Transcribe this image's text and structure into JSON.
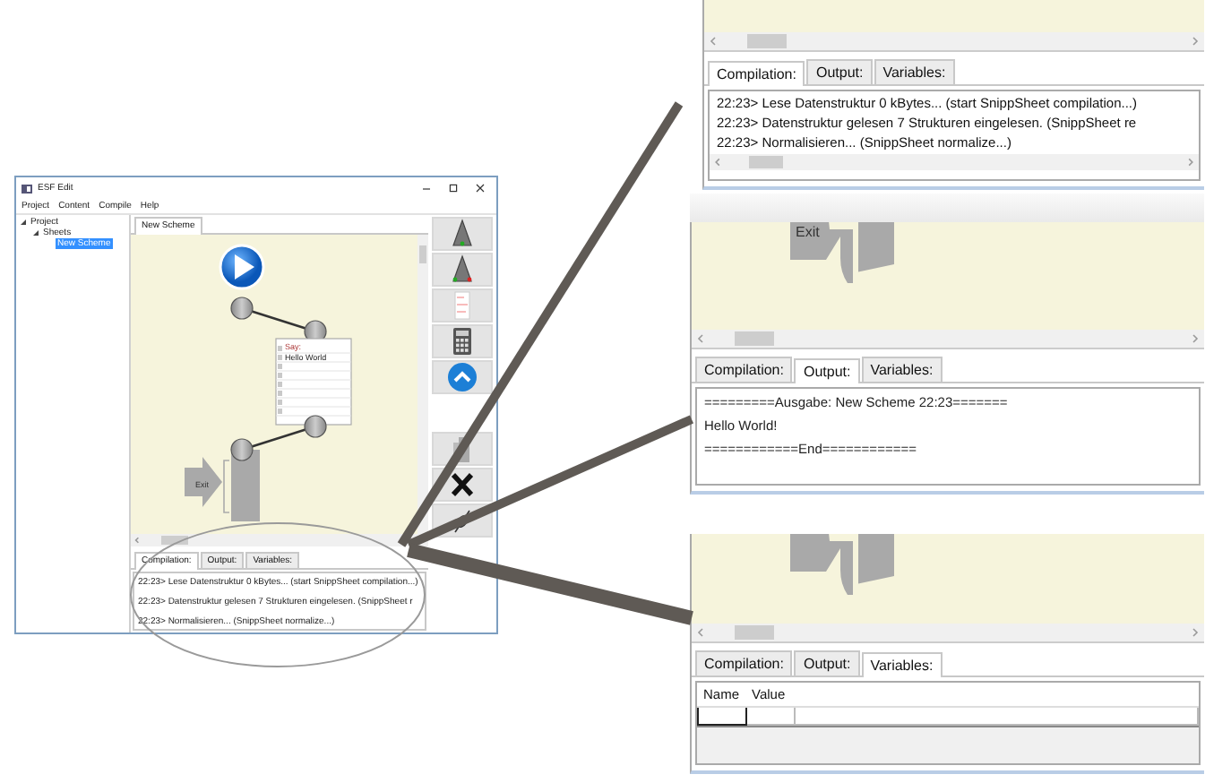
{
  "main_window": {
    "title": "ESF Edit",
    "menu": [
      "Project",
      "Content",
      "Compile",
      "Help"
    ],
    "tree": [
      {
        "label": "Project",
        "expanded": true,
        "children": [
          {
            "label": "Sheets",
            "expanded": true,
            "children": [
              {
                "label": "New Scheme",
                "selected": true
              }
            ]
          }
        ]
      }
    ],
    "editor_tabs": [
      {
        "label": "New Scheme",
        "selected": true
      }
    ],
    "scheme": {
      "say_block": [
        "Say:",
        "Hello World"
      ],
      "exit_label": "Exit"
    },
    "bottom_tabs": [
      {
        "label": "Compilation:",
        "selected": true
      },
      {
        "label": "Output:",
        "selected": false
      },
      {
        "label": "Variables:",
        "selected": false
      }
    ],
    "log_lines": [
      "22:23> Lese Datenstruktur 0 kBytes... (start SnippSheet compilation...)",
      "22:23> Datenstruktur gelesen 7 Strukturen eingelesen. (SnippSheet r",
      "22:23> Normalisieren... (SnippSheet normalize...)"
    ]
  },
  "zoom_panels": [
    {
      "kind": "log",
      "tabs": [
        {
          "label": "Compilation:",
          "selected": true
        },
        {
          "label": "Output:",
          "selected": false
        },
        {
          "label": "Variables:",
          "selected": false
        }
      ],
      "lines": [
        "22:23> Lese Datenstruktur 0 kBytes... (start SnippSheet compilation...)",
        "22:23> Datenstruktur gelesen 7 Strukturen eingelesen. (SnippSheet re",
        "22:23> Normalisieren... (SnippSheet normalize...)"
      ]
    },
    {
      "kind": "output",
      "exit_label": "Exit",
      "tabs": [
        {
          "label": "Compilation:",
          "selected": false
        },
        {
          "label": "Output:",
          "selected": true
        },
        {
          "label": "Variables:",
          "selected": false
        }
      ],
      "lines": [
        "=========Ausgabe: New Scheme   22:23=======",
        "Hello World!",
        "============End============"
      ]
    },
    {
      "kind": "variables",
      "tabs": [
        {
          "label": "Compilation:",
          "selected": false
        },
        {
          "label": "Output:",
          "selected": false
        },
        {
          "label": "Variables:",
          "selected": true
        }
      ],
      "columns": [
        "Name",
        "Value"
      ]
    }
  ]
}
